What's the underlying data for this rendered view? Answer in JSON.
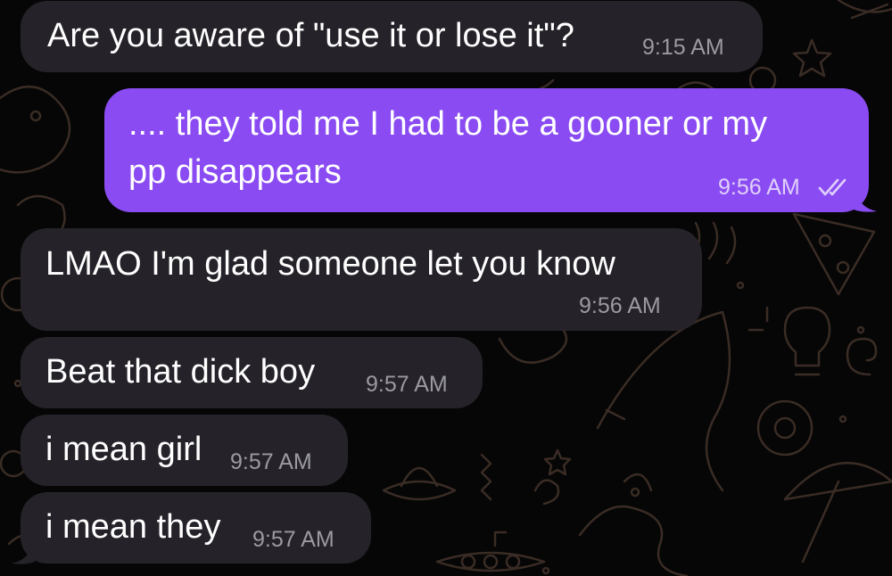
{
  "conversation": {
    "messages": [
      {
        "direction": "incoming",
        "text": "Are you aware of \"use it or lose it\"?",
        "time": "9:15 AM"
      },
      {
        "direction": "outgoing",
        "text_line1": ".... they told me I had to be a gooner or my",
        "text_line2": "pp disappears",
        "time": "9:56 AM",
        "status": "read-double-check-icon"
      },
      {
        "direction": "incoming",
        "text": "LMAO I'm glad someone let you know",
        "time": "9:56 AM"
      },
      {
        "direction": "incoming",
        "text": "Beat that dick boy",
        "time": "9:57 AM"
      },
      {
        "direction": "incoming",
        "text": "i mean girl",
        "time": "9:57 AM"
      },
      {
        "direction": "incoming",
        "text": "i mean they",
        "time": "9:57 AM"
      }
    ]
  },
  "colors": {
    "background": "#060606",
    "incoming_bubble": "#252329",
    "outgoing_bubble": "#8a4cf2",
    "doodle_pattern": "#3a2c25"
  }
}
